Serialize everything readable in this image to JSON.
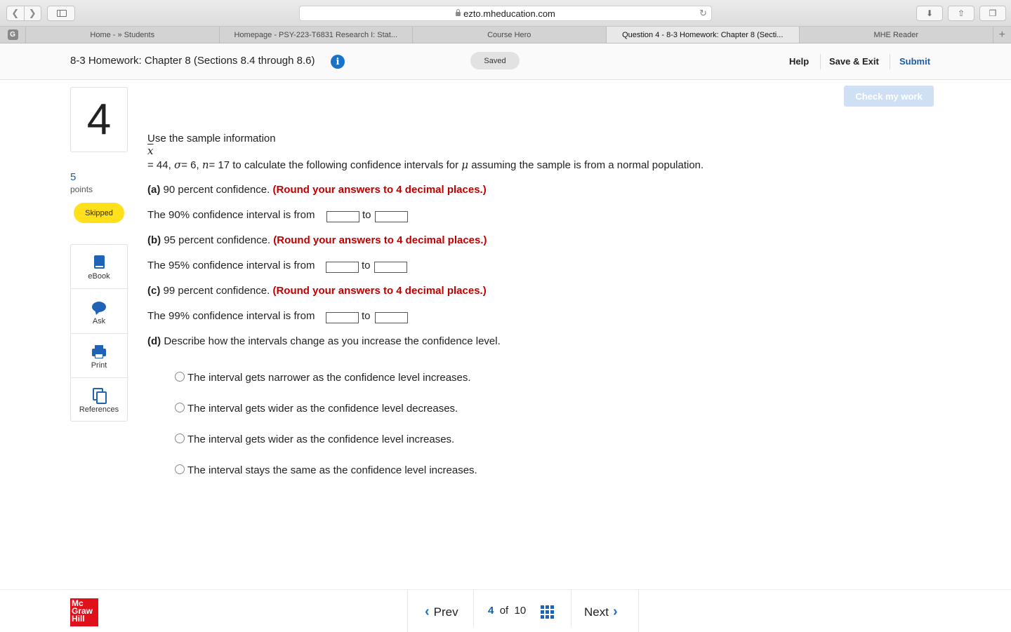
{
  "browser": {
    "url": "ezto.mheducation.com",
    "tabs": [
      {
        "label": "Home - » Students",
        "active": false
      },
      {
        "label": "Homepage - PSY-223-T6831 Research I: Stat...",
        "active": false
      },
      {
        "label": "Course Hero",
        "active": false
      },
      {
        "label": "Question 4 - 8-3 Homework: Chapter 8 (Secti...",
        "active": true
      },
      {
        "label": "MHE Reader",
        "active": false
      }
    ],
    "favicon_letter": "G"
  },
  "header": {
    "title": "8-3 Homework: Chapter 8 (Sections 8.4 through 8.6)",
    "saved_label": "Saved",
    "help": "Help",
    "save_exit": "Save & Exit",
    "submit": "Submit"
  },
  "question": {
    "number": "4",
    "points_value": "5",
    "points_label": "points",
    "status": "Skipped",
    "check_button": "Check my work",
    "intro": "Use the sample information",
    "xbar": "x",
    "given_eq1": "= 44, ",
    "sigma": "σ",
    "given_eq2": "= 6, ",
    "n": "n",
    "given_eq3": "= 17 to calculate the following confidence intervals for ",
    "mu": "μ",
    "given_eq4": " assuming the sample is from a normal population.",
    "parts": [
      {
        "label": "(a)",
        "text": " 90 percent confidence. ",
        "note": "(Round your answers to 4 decimal places.)",
        "interval_text": "The 90% confidence interval is from",
        "to": "to"
      },
      {
        "label": "(b)",
        "text": " 95 percent confidence. ",
        "note": "(Round your answers to 4 decimal places.)",
        "interval_text": "The 95% confidence interval is from",
        "to": "to"
      },
      {
        "label": "(c)",
        "text": " 99 percent confidence. ",
        "note": "(Round your answers to 4 decimal places.)",
        "interval_text": "The 99% confidence interval is from",
        "to": "to"
      }
    ],
    "part_d": {
      "label": "(d)",
      "text": " Describe how the intervals change as you increase the confidence level."
    },
    "options": [
      "The interval gets narrower as the confidence level increases.",
      "The interval gets wider as the confidence level decreases.",
      "The interval gets wider as the confidence level increases.",
      "The interval stays the same as the confidence level increases."
    ]
  },
  "tools": [
    "eBook",
    "Ask",
    "Print",
    "References"
  ],
  "footer": {
    "logo_lines": [
      "Mc",
      "Graw",
      "Hill"
    ],
    "prev": "Prev",
    "current": "4",
    "of": "of",
    "total": "10",
    "next": "Next"
  },
  "colors": {
    "accent": "#1a73c8",
    "warning_red": "#c00000",
    "status_yellow": "#ffe01b",
    "brand_red": "#e0111b"
  }
}
